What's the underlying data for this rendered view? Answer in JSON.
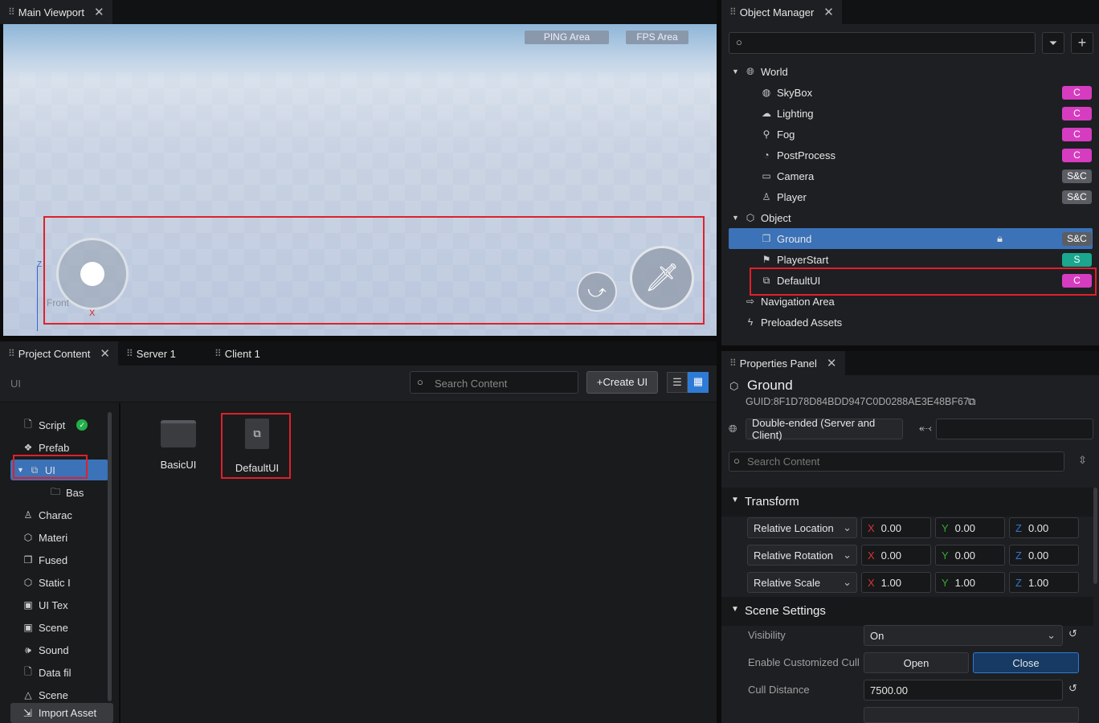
{
  "viewport": {
    "tab": "Main Viewport",
    "ping": "PING Area",
    "fps": "FPS Area",
    "axis_label": "Front",
    "axis_x": "X",
    "axis_z": "Z"
  },
  "object_manager": {
    "tab": "Object Manager",
    "search_placeholder": "",
    "tree": [
      {
        "label": "World",
        "icon": "globe-icon",
        "level": 0,
        "expanded": true
      },
      {
        "label": "SkyBox",
        "icon": "sky-icon",
        "level": 1,
        "badge": "C"
      },
      {
        "label": "Lighting",
        "icon": "cloud-icon",
        "level": 1,
        "badge": "C"
      },
      {
        "label": "Fog",
        "icon": "fog-icon",
        "level": 1,
        "badge": "C"
      },
      {
        "label": "PostProcess",
        "icon": "palette-icon",
        "level": 1,
        "badge": "C"
      },
      {
        "label": "Camera",
        "icon": "camera-icon",
        "level": 1,
        "badge": "S&C"
      },
      {
        "label": "Player",
        "icon": "player-icon",
        "level": 1,
        "badge": "S&C"
      },
      {
        "label": "Object",
        "icon": "cube-icon",
        "level": 0,
        "expanded": true
      },
      {
        "label": "Ground",
        "icon": "box-icon",
        "level": 1,
        "badge": "S&C",
        "selected": true,
        "locked": true
      },
      {
        "label": "PlayerStart",
        "icon": "flag-icon",
        "level": 1,
        "badge": "S"
      },
      {
        "label": "DefaultUI",
        "icon": "ui-icon",
        "level": 1,
        "badge": "C"
      },
      {
        "label": "Navigation Area",
        "icon": "signpost-icon",
        "level": 0
      },
      {
        "label": "Preloaded Assets",
        "icon": "bolt-icon",
        "level": 0
      }
    ],
    "badge_colors": {
      "C": "#d63cc0",
      "S&C": "#5a5d63",
      "S": "#1aa68f"
    }
  },
  "project": {
    "tabs": [
      "Project Content",
      "Server 1",
      "Client 1"
    ],
    "path": "UI",
    "search_placeholder": "Search Content",
    "create_label": "Create UI",
    "sidebar": [
      {
        "label": "Script",
        "icon": "file-icon",
        "status": "ok"
      },
      {
        "label": "Prefab",
        "icon": "prefab-icon"
      },
      {
        "label": "UI",
        "icon": "ui-icon",
        "selected": true
      },
      {
        "label": "Bas",
        "icon": "folder-icon",
        "child": true
      },
      {
        "label": "Charac",
        "icon": "player-icon"
      },
      {
        "label": "Materi",
        "icon": "cube-icon"
      },
      {
        "label": "Fused",
        "icon": "box-icon"
      },
      {
        "label": "Static I",
        "icon": "cube-icon"
      },
      {
        "label": "UI Tex",
        "icon": "image-icon"
      },
      {
        "label": "Scene",
        "icon": "image-icon"
      },
      {
        "label": "Sound",
        "icon": "sound-icon"
      },
      {
        "label": "Data fil",
        "icon": "file-icon"
      },
      {
        "label": "Scene",
        "icon": "terrain-icon"
      }
    ],
    "import_label": "Import Asset",
    "assets": [
      {
        "label": "BasicUI",
        "type": "folder"
      },
      {
        "label": "DefaultUI",
        "type": "ui-file"
      }
    ]
  },
  "properties": {
    "tab": "Properties Panel",
    "name": "Ground",
    "guid": "GUID:8F1D78D84BDD947C0D0288AE3E48BF67",
    "network": "Double-ended (Server and Client)",
    "tag_value": "",
    "search_placeholder": "Search Content",
    "transform_title": "Transform",
    "transform": [
      {
        "label": "Relative Location",
        "x": "0.00",
        "y": "0.00",
        "z": "0.00"
      },
      {
        "label": "Relative Rotation",
        "x": "0.00",
        "y": "0.00",
        "z": "0.00"
      },
      {
        "label": "Relative Scale",
        "x": "1.00",
        "y": "1.00",
        "z": "1.00"
      }
    ],
    "scene_title": "Scene Settings",
    "visibility_label": "Visibility",
    "visibility_value": "On",
    "cull_label": "Enable Customized Cull",
    "cull_open": "Open",
    "cull_close": "Close",
    "distance_label": "Cull Distance",
    "distance_value": "7500.00"
  }
}
